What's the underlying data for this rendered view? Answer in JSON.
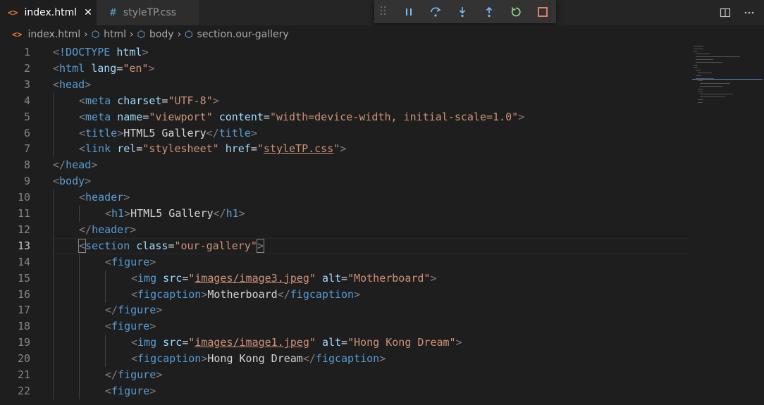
{
  "tabs": [
    {
      "label": "index.html",
      "icon": "html-file-icon",
      "close": "✕"
    },
    {
      "label": "styleTP.css",
      "icon": "css-file-icon",
      "glyph": "#"
    }
  ],
  "breadcrumb": [
    "index.html",
    "html",
    "body",
    "section.our-gallery"
  ],
  "debug": [
    "pause",
    "step-over",
    "step-into",
    "step-out",
    "restart",
    "stop"
  ],
  "code": [
    {
      "n": "1",
      "segs": [
        [
          "t-br",
          "<"
        ],
        [
          "t-doc",
          "!DOCTYPE"
        ],
        [
          "t-txt",
          " "
        ],
        [
          "t-attr",
          "html"
        ],
        [
          "t-br",
          ">"
        ]
      ]
    },
    {
      "n": "2",
      "segs": [
        [
          "t-br",
          "<"
        ],
        [
          "t-tag",
          "html"
        ],
        [
          "t-txt",
          " "
        ],
        [
          "t-attr",
          "lang"
        ],
        [
          "t-txt",
          "="
        ],
        [
          "t-str",
          "\"en\""
        ],
        [
          "t-br",
          ">"
        ]
      ]
    },
    {
      "n": "3",
      "segs": [
        [
          "t-br",
          "<"
        ],
        [
          "t-tag",
          "head"
        ],
        [
          "t-br",
          ">"
        ]
      ]
    },
    {
      "n": "4",
      "indent": 1,
      "segs": [
        [
          "t-br",
          "<"
        ],
        [
          "t-tag",
          "meta"
        ],
        [
          "t-txt",
          " "
        ],
        [
          "t-attr",
          "charset"
        ],
        [
          "t-txt",
          "="
        ],
        [
          "t-str",
          "\"UTF-8\""
        ],
        [
          "t-br",
          ">"
        ]
      ]
    },
    {
      "n": "5",
      "indent": 1,
      "segs": [
        [
          "t-br",
          "<"
        ],
        [
          "t-tag",
          "meta"
        ],
        [
          "t-txt",
          " "
        ],
        [
          "t-attr",
          "name"
        ],
        [
          "t-txt",
          "="
        ],
        [
          "t-str",
          "\"viewport\""
        ],
        [
          "t-txt",
          " "
        ],
        [
          "t-attr",
          "content"
        ],
        [
          "t-txt",
          "="
        ],
        [
          "t-str",
          "\"width=device-width, initial-scale=1.0\""
        ],
        [
          "t-br",
          ">"
        ]
      ]
    },
    {
      "n": "6",
      "indent": 1,
      "segs": [
        [
          "t-br",
          "<"
        ],
        [
          "t-tag",
          "title"
        ],
        [
          "t-br",
          ">"
        ],
        [
          "t-txt",
          "HTML5 Gallery"
        ],
        [
          "t-br",
          "</"
        ],
        [
          "t-tag",
          "title"
        ],
        [
          "t-br",
          ">"
        ]
      ]
    },
    {
      "n": "7",
      "indent": 1,
      "segs": [
        [
          "t-br",
          "<"
        ],
        [
          "t-tag",
          "link"
        ],
        [
          "t-txt",
          " "
        ],
        [
          "t-attr",
          "rel"
        ],
        [
          "t-txt",
          "="
        ],
        [
          "t-str",
          "\"stylesheet\""
        ],
        [
          "t-txt",
          " "
        ],
        [
          "t-attr",
          "href"
        ],
        [
          "t-txt",
          "="
        ],
        [
          "t-str",
          "\""
        ],
        [
          "t-str u",
          "styleTP.css"
        ],
        [
          "t-str",
          "\""
        ],
        [
          "t-br",
          ">"
        ]
      ]
    },
    {
      "n": "8",
      "segs": [
        [
          "t-br",
          "</"
        ],
        [
          "t-tag",
          "head"
        ],
        [
          "t-br",
          ">"
        ]
      ]
    },
    {
      "n": "9",
      "segs": [
        [
          "t-br",
          "<"
        ],
        [
          "t-tag",
          "body"
        ],
        [
          "t-br",
          ">"
        ]
      ]
    },
    {
      "n": "10",
      "indent": 1,
      "segs": [
        [
          "t-br",
          "<"
        ],
        [
          "t-tag",
          "header"
        ],
        [
          "t-br",
          ">"
        ]
      ]
    },
    {
      "n": "11",
      "indent": 2,
      "segs": [
        [
          "t-br",
          "<"
        ],
        [
          "t-tag",
          "h1"
        ],
        [
          "t-br",
          ">"
        ],
        [
          "t-txt",
          "HTML5 Gallery"
        ],
        [
          "t-br",
          "</"
        ],
        [
          "t-tag",
          "h1"
        ],
        [
          "t-br",
          ">"
        ]
      ]
    },
    {
      "n": "12",
      "indent": 1,
      "segs": [
        [
          "t-br",
          "</"
        ],
        [
          "t-tag",
          "header"
        ],
        [
          "t-br",
          ">"
        ]
      ]
    },
    {
      "n": "13",
      "indent": 1,
      "current": true,
      "segs": [
        [
          "t-br bracket-match",
          "<"
        ],
        [
          "t-tag",
          "section"
        ],
        [
          "t-txt",
          " "
        ],
        [
          "t-attr",
          "class"
        ],
        [
          "t-txt",
          "="
        ],
        [
          "t-str",
          "\"our-gallery\""
        ],
        [
          "t-br bracket-match",
          ">"
        ]
      ]
    },
    {
      "n": "14",
      "indent": 2,
      "segs": [
        [
          "t-br",
          "<"
        ],
        [
          "t-tag",
          "figure"
        ],
        [
          "t-br",
          ">"
        ]
      ]
    },
    {
      "n": "15",
      "indent": 3,
      "segs": [
        [
          "t-br",
          "<"
        ],
        [
          "t-tag",
          "img"
        ],
        [
          "t-txt",
          " "
        ],
        [
          "t-attr",
          "src"
        ],
        [
          "t-txt",
          "="
        ],
        [
          "t-str",
          "\""
        ],
        [
          "t-str u",
          "images/image3.jpeg"
        ],
        [
          "t-str",
          "\""
        ],
        [
          "t-txt",
          " "
        ],
        [
          "t-attr",
          "alt"
        ],
        [
          "t-txt",
          "="
        ],
        [
          "t-str",
          "\"Motherboard\""
        ],
        [
          "t-br",
          ">"
        ]
      ]
    },
    {
      "n": "16",
      "indent": 3,
      "segs": [
        [
          "t-br",
          "<"
        ],
        [
          "t-tag",
          "figcaption"
        ],
        [
          "t-br",
          ">"
        ],
        [
          "t-txt",
          "Motherboard"
        ],
        [
          "t-br",
          "</"
        ],
        [
          "t-tag",
          "figcaption"
        ],
        [
          "t-br",
          ">"
        ]
      ]
    },
    {
      "n": "17",
      "indent": 2,
      "segs": [
        [
          "t-br",
          "</"
        ],
        [
          "t-tag",
          "figure"
        ],
        [
          "t-br",
          ">"
        ]
      ]
    },
    {
      "n": "18",
      "indent": 2,
      "segs": [
        [
          "t-br",
          "<"
        ],
        [
          "t-tag",
          "figure"
        ],
        [
          "t-br",
          ">"
        ]
      ]
    },
    {
      "n": "19",
      "indent": 3,
      "segs": [
        [
          "t-br",
          "<"
        ],
        [
          "t-tag",
          "img"
        ],
        [
          "t-txt",
          " "
        ],
        [
          "t-attr",
          "src"
        ],
        [
          "t-txt",
          "="
        ],
        [
          "t-str",
          "\""
        ],
        [
          "t-str u",
          "images/image1.jpeg"
        ],
        [
          "t-str",
          "\""
        ],
        [
          "t-txt",
          " "
        ],
        [
          "t-attr",
          "alt"
        ],
        [
          "t-txt",
          "="
        ],
        [
          "t-str",
          "\"Hong Kong Dream\""
        ],
        [
          "t-br",
          ">"
        ]
      ]
    },
    {
      "n": "20",
      "indent": 3,
      "segs": [
        [
          "t-br",
          "<"
        ],
        [
          "t-tag",
          "figcaption"
        ],
        [
          "t-br",
          ">"
        ],
        [
          "t-txt",
          "Hong Kong Dream"
        ],
        [
          "t-br",
          "</"
        ],
        [
          "t-tag",
          "figcaption"
        ],
        [
          "t-br",
          ">"
        ]
      ]
    },
    {
      "n": "21",
      "indent": 2,
      "segs": [
        [
          "t-br",
          "</"
        ],
        [
          "t-tag",
          "figure"
        ],
        [
          "t-br",
          ">"
        ]
      ]
    },
    {
      "n": "22",
      "indent": 2,
      "segs": [
        [
          "t-br",
          "<"
        ],
        [
          "t-tag",
          "figure"
        ],
        [
          "t-br",
          ">"
        ]
      ]
    }
  ]
}
